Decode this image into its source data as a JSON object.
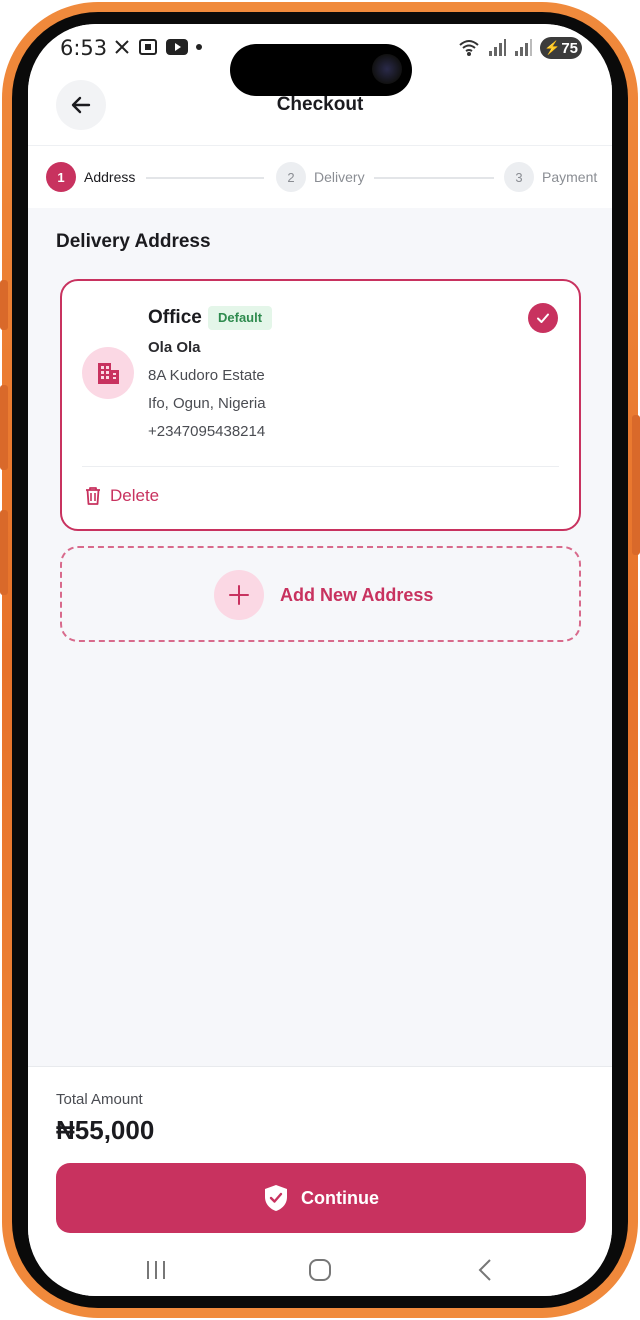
{
  "status_bar": {
    "time": "6:53",
    "battery": "75",
    "icons_left": [
      "x-icon",
      "screenshot-icon",
      "youtube-icon",
      "dot-icon"
    ],
    "icons_right": [
      "wifi-icon",
      "signal-icon",
      "signal-icon",
      "battery-icon"
    ]
  },
  "header": {
    "title": "Checkout",
    "back_icon": "arrow-left-icon"
  },
  "stepper": {
    "steps": [
      {
        "number": "1",
        "label": "Address",
        "state": "active"
      },
      {
        "number": "2",
        "label": "Delivery",
        "state": "inactive"
      },
      {
        "number": "3",
        "label": "Payment",
        "state": "inactive"
      }
    ]
  },
  "main": {
    "section_title": "Delivery Address",
    "address": {
      "label": "Office",
      "badge": "Default",
      "name": "Ola Ola",
      "line1": "8A Kudoro Estate",
      "line2": "Ifo, Ogun, Nigeria",
      "phone": "+2347095438214",
      "delete_label": "Delete",
      "selected": true,
      "icon": "building-icon"
    },
    "add_new_label": "Add New Address"
  },
  "footer": {
    "total_label": "Total Amount",
    "total_value": "₦55,000",
    "continue_label": "Continue"
  },
  "colors": {
    "accent": "#c8325f",
    "accent_light": "#fbd8e4",
    "badge_bg": "#e4f6e9",
    "badge_text": "#2e8b4e",
    "frame": "#e7722a"
  }
}
